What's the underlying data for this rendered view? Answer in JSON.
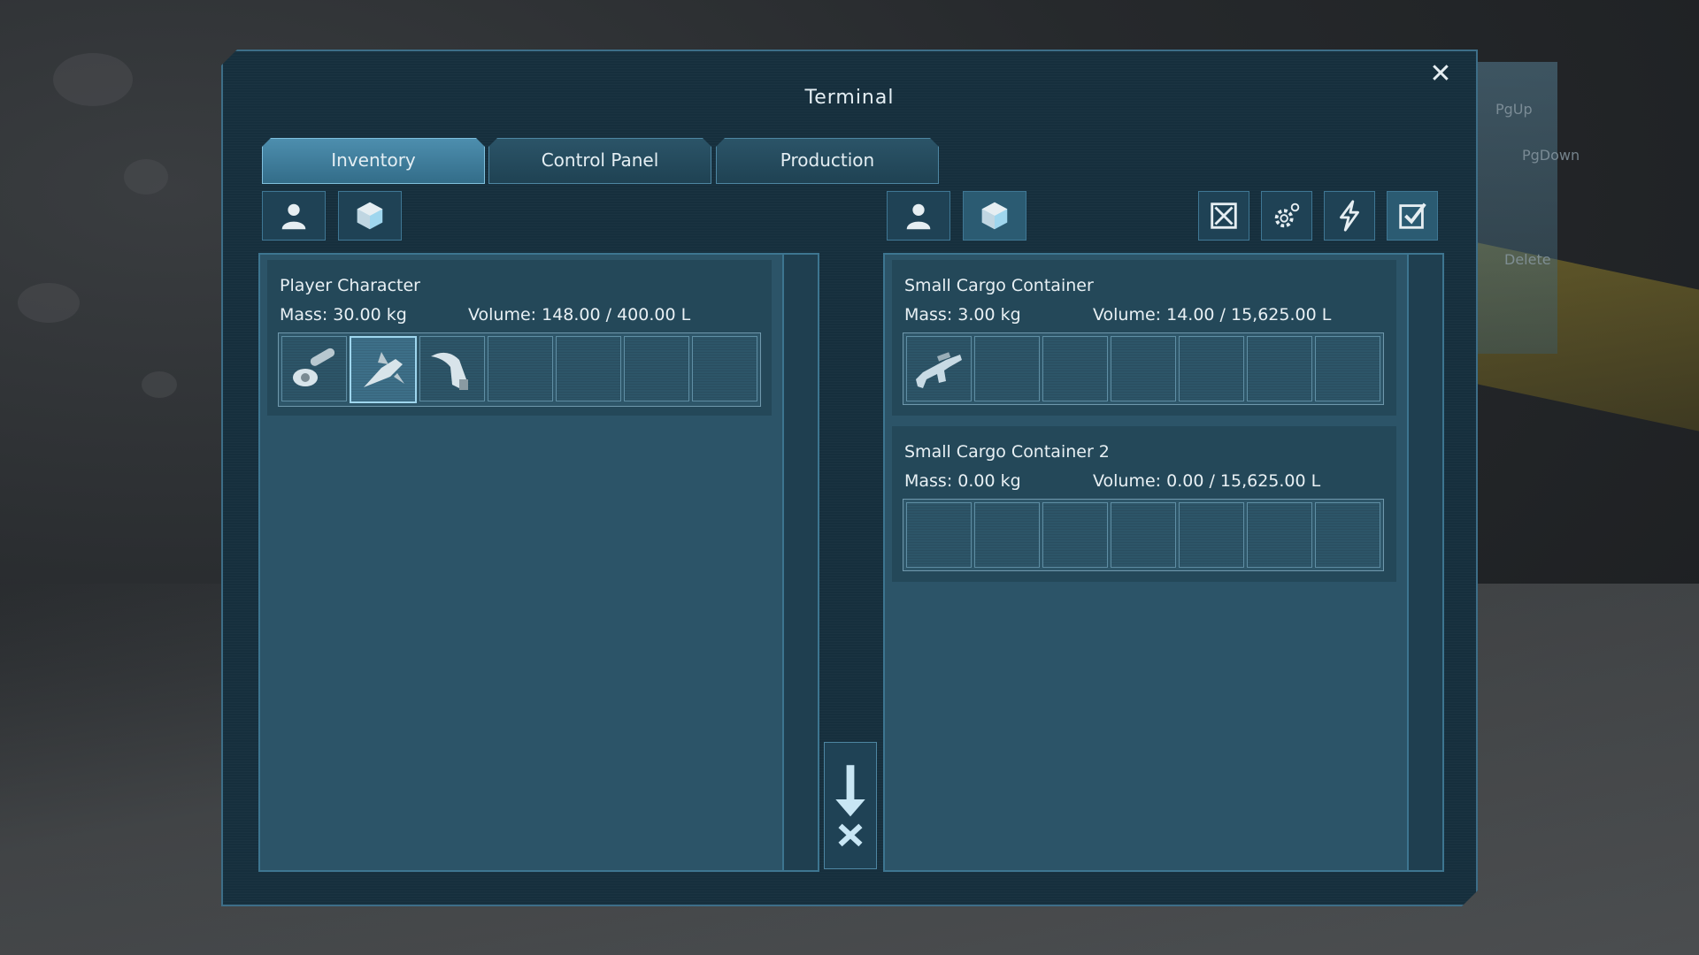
{
  "background_hints": [
    "PgUp",
    "PgDown",
    "Delete"
  ],
  "terminal": {
    "title": "Terminal",
    "close_label": "✕",
    "tabs": [
      {
        "label": "Inventory",
        "active": true
      },
      {
        "label": "Control Panel",
        "active": false
      },
      {
        "label": "Production",
        "active": false
      }
    ]
  },
  "left_panel": {
    "filters": [
      "person-icon",
      "cube-icon"
    ],
    "inventories": [
      {
        "name": "Player Character",
        "mass": "Mass: 30.00 kg",
        "volume": "Volume: 148.00 / 400.00 L",
        "slots": [
          "angle-grinder-icon",
          "welder-icon",
          "hand-drill-icon",
          "",
          "",
          "",
          ""
        ],
        "selected_slot": 1
      }
    ]
  },
  "right_panel": {
    "filters": [
      "person-icon",
      "cube-icon"
    ],
    "actions": [
      "hide-empty-icon",
      "settings-icon",
      "power-icon",
      "checkbox-icon"
    ],
    "inventories": [
      {
        "name": "Small Cargo Container",
        "mass": "Mass: 3.00 kg",
        "volume": "Volume: 14.00 / 15,625.00 L",
        "slots": [
          "rifle-icon",
          "",
          "",
          "",
          "",
          "",
          ""
        ]
      },
      {
        "name": "Small Cargo Container 2",
        "mass": "Mass: 0.00 kg",
        "volume": "Volume: 0.00 / 15,625.00 L",
        "slots": [
          "",
          "",
          "",
          "",
          "",
          "",
          ""
        ]
      }
    ]
  },
  "colors": {
    "panel": "#2c5468",
    "accent": "#7fc0de",
    "frame": "#3d6e88"
  }
}
